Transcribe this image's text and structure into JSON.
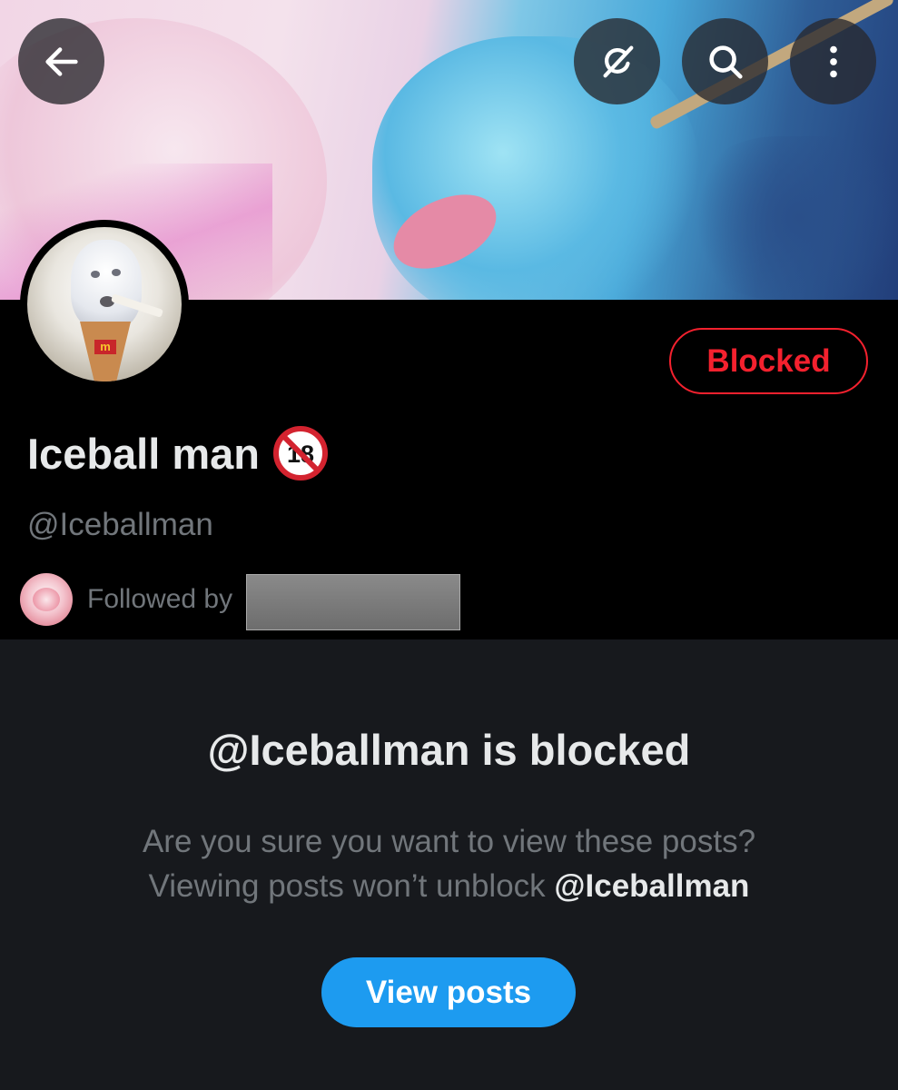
{
  "header": {
    "buttons": {
      "back": "arrow-left-icon",
      "grok": "grok-icon",
      "search": "search-icon",
      "more": "more-vertical-icon"
    }
  },
  "profile": {
    "display_name": "Iceball man",
    "name_badge_icon": "no-under-18-icon",
    "handle": "@Iceballman",
    "follow_button_label": "Blocked",
    "followed_by_label": "Followed by"
  },
  "blocked_notice": {
    "title": "@Iceballman is blocked",
    "line1": "Are you sure you want to view these posts?",
    "line2_prefix": "Viewing posts won’t unblock ",
    "line2_handle": "@Iceballman",
    "button_label": "View posts"
  },
  "colors": {
    "background": "#000000",
    "panel": "#17191d",
    "blocked_red": "#f4212e",
    "accent_blue": "#1d9bf0",
    "text_primary": "#e7e9ea",
    "text_secondary": "#71767b"
  }
}
